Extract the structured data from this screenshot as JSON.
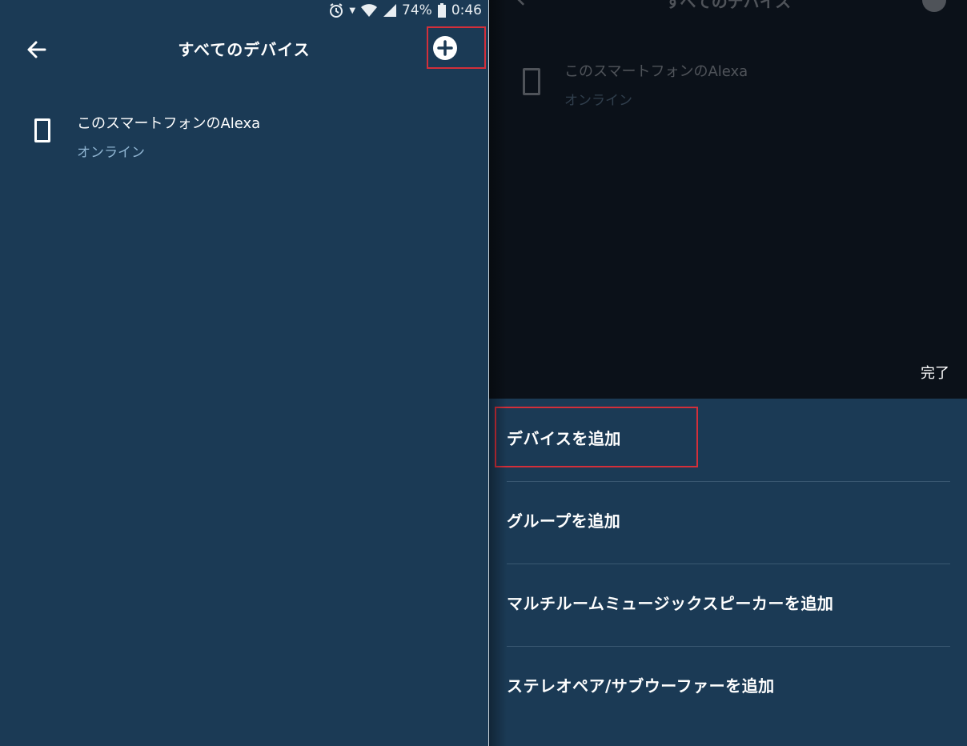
{
  "status_bar": {
    "battery": "74%",
    "time": "0:46"
  },
  "left_screen": {
    "title": "すべてのデバイス",
    "device": {
      "name": "このスマートフォンのAlexa",
      "status": "オンライン"
    }
  },
  "right_screen": {
    "dimmed_title": "すべてのデバイス",
    "dimmed_device": {
      "name": "このスマートフォンのAlexa",
      "status": "オンライン"
    },
    "done_label": "完了",
    "menu_items": [
      {
        "label": "デバイスを追加"
      },
      {
        "label": "グループを追加"
      },
      {
        "label": "マルチルームミュージックスピーカーを追加"
      },
      {
        "label": "ステレオペア/サブウーファーを追加"
      }
    ]
  },
  "colors": {
    "background": "#1b3a55",
    "dim_overlay": "#0b1119",
    "highlight": "#d32f3a",
    "secondary_text": "#8fb4d1"
  }
}
